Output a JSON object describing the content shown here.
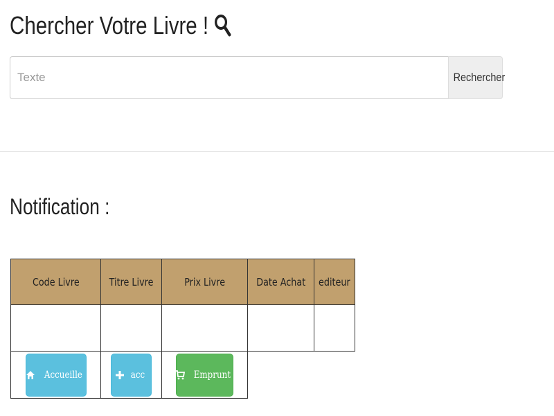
{
  "header": {
    "title": "Chercher Votre Livre !",
    "search_icon": "search-icon"
  },
  "search": {
    "placeholder": "Texte",
    "value": "",
    "button_label": "Rechercher"
  },
  "notification": {
    "heading": "Notification :"
  },
  "table": {
    "columns": [
      "Code Livre",
      "Titre Livre",
      "Prix Livre",
      "Date Achat",
      "editeur"
    ],
    "header_color": "#c1a06e",
    "rows": [
      [
        "",
        "",
        "",
        "",
        ""
      ]
    ]
  },
  "actions": {
    "home": {
      "label": "Accueille",
      "icon": "home-icon",
      "color": "#5bc0de"
    },
    "add": {
      "label": "acc",
      "icon": "plus-icon",
      "color": "#5bc0de"
    },
    "borrow": {
      "label": "Emprunt",
      "icon": "cart-icon",
      "color": "#5cb85c"
    }
  }
}
